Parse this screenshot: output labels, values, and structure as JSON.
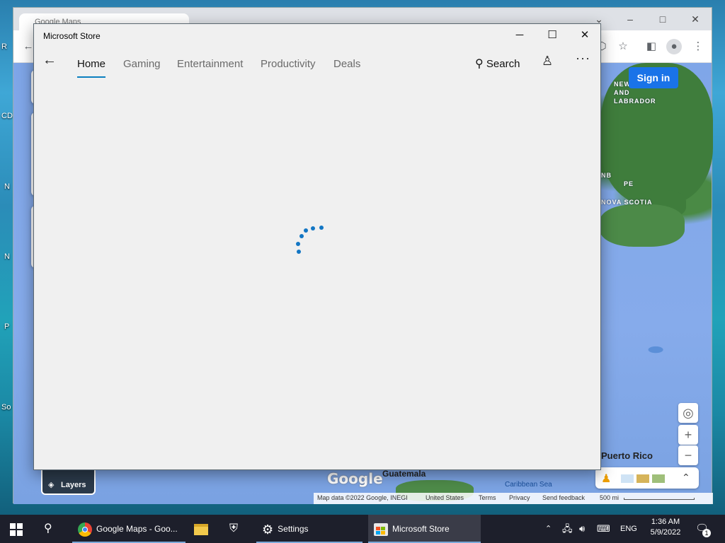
{
  "desktop": {
    "labels": [
      "R",
      "CD",
      "N",
      "N",
      "P",
      "So"
    ]
  },
  "chrome": {
    "tab_title": "Google Maps",
    "window_controls": [
      "chevron-down",
      "minimize",
      "maximize",
      "close"
    ],
    "map": {
      "sign_in": "Sign in",
      "region_labels": [
        "NEWFOUNDLAND AND LABRADOR",
        "NB",
        "PE",
        "NOVA SCOTIA"
      ],
      "place_labels": [
        "Puerto Rico",
        "Guatemala",
        "Caribbean Sea"
      ],
      "layers_label": "Layers",
      "footer": {
        "map_data": "Map data ©2022 Google, INEGI",
        "country": "United States",
        "terms": "Terms",
        "privacy": "Privacy",
        "feedback": "Send feedback",
        "scale": "500 mi"
      },
      "google_logo": "Google"
    }
  },
  "store": {
    "title": "Microsoft Store",
    "nav_tabs": [
      "Home",
      "Gaming",
      "Entertainment",
      "Productivity",
      "Deals"
    ],
    "active_tab": "Home",
    "search_label": "Search",
    "accent": "#0a7fbf"
  },
  "taskbar": {
    "items": [
      {
        "label": "Google Maps - Goo...",
        "icon": "chrome-icon"
      },
      {
        "label": "Settings",
        "icon": "gear-icon"
      },
      {
        "label": "Microsoft Store",
        "icon": "store-icon"
      }
    ],
    "tray": {
      "language": "ENG",
      "time": "1:36 AM",
      "date": "5/9/2022",
      "notification_count": "1"
    }
  }
}
